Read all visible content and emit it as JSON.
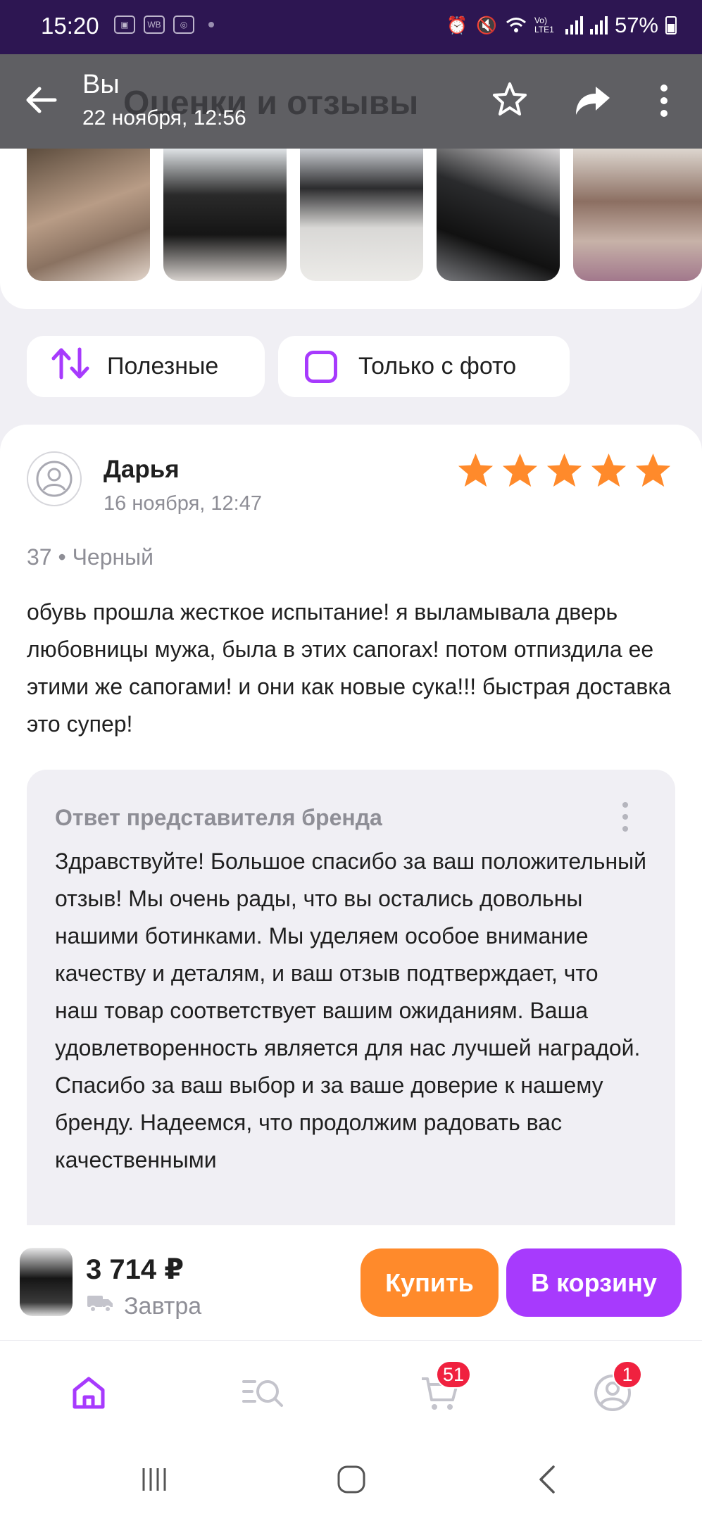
{
  "status_bar": {
    "time": "15:20",
    "mini_icons": [
      "gallery-icon",
      "WB",
      "app-icon"
    ],
    "network_label": "Vo) LTE1",
    "battery": "57%"
  },
  "header": {
    "title": "Вы",
    "subtitle": "22 ноября, 12:56",
    "background_title": "Оценки и отзывы"
  },
  "filters": {
    "useful_label": "Полезные",
    "photo_only_label": "Только с фото"
  },
  "review": {
    "author": "Дарья",
    "date": "16 ноября, 12:47",
    "rating": 5,
    "variant": "37 • Черный",
    "text": "обувь прошла жесткое испытание! я выламывала дверь любовницы мужа, была в этих сапогах! потом отпиздила ее этими же сапогами! и они как новые сука!!! быстрая доставка это супер!",
    "reply": {
      "title": "Ответ представителя бренда",
      "text": "Здравствуйте! Большое спасибо за ваш положительный отзыв! Мы очень рады, что вы остались довольны нашими ботинками. Мы уделяем особое внимание качеству и деталям, и ваш отзыв подтверждает, что наш товар соответствует вашим ожиданиям. Ваша удовлетворенность является для нас лучшей наградой. Спасибо за ваш выбор и за ваше доверие к нашему бренду. Надеемся, что продолжим радовать вас качественными"
    }
  },
  "buy_bar": {
    "price": "3 714 ₽",
    "delivery": "Завтра",
    "buy_label": "Купить",
    "cart_label": "В корзину"
  },
  "tab_bar": {
    "cart_badge": "51",
    "profile_badge": "1"
  },
  "colors": {
    "accent": "#a73afd",
    "orange": "#ff8a2b",
    "star": "#ff8a2b",
    "badge": "#f0213f"
  }
}
